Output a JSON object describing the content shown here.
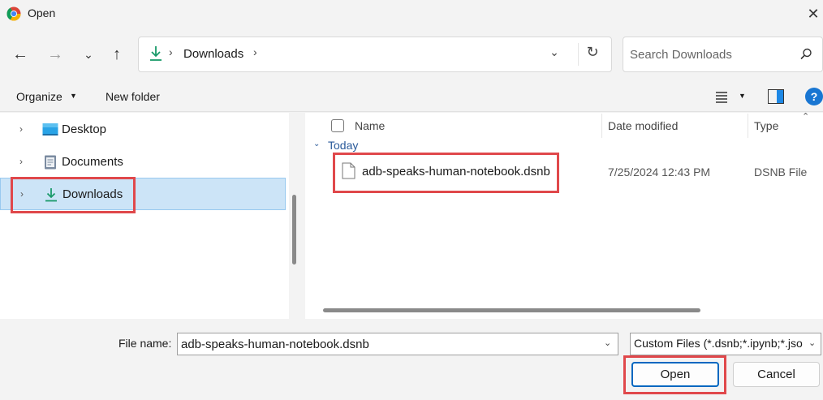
{
  "window": {
    "title": "Open",
    "close_glyph": "✕",
    "app_icon": "chrome-icon"
  },
  "nav": {
    "back_glyph": "←",
    "forward_glyph": "→",
    "recent_glyph": "⌄",
    "up_glyph": "↑",
    "address_icon": "download-icon",
    "address_sep": "›",
    "address_path": "Downloads",
    "address_dropdown_glyph": "⌄",
    "refresh_glyph": "↻",
    "search_placeholder": "Search Downloads"
  },
  "toolbar": {
    "organize_label": "Organize",
    "organize_caret": "▼",
    "new_folder_label": "New folder",
    "view_caret": "▼",
    "help_label": "?"
  },
  "tree": {
    "items": [
      {
        "label": "Desktop",
        "icon": "desktop-icon",
        "chevron": "›"
      },
      {
        "label": "Documents",
        "icon": "documents-icon",
        "chevron": "›"
      },
      {
        "label": "Downloads",
        "icon": "download-icon",
        "chevron": "›",
        "selected": true
      }
    ]
  },
  "files": {
    "columns": {
      "name": "Name",
      "date": "Date modified",
      "type": "Type"
    },
    "scroll_up_glyph": "⌃",
    "group": {
      "toggle_glyph": "⌄",
      "label": "Today"
    },
    "rows": [
      {
        "name": "adb-speaks-human-notebook.dsnb",
        "date": "7/25/2024 12:43 PM",
        "type": "DSNB File",
        "icon": "file-icon"
      }
    ]
  },
  "footer": {
    "file_name_label": "File name:",
    "file_name_value": "adb-speaks-human-notebook.dsnb",
    "file_name_caret": "⌄",
    "filter_value": "Custom Files (*.dsnb;*.ipynb;*.jso",
    "filter_caret": "⌄",
    "open_label": "Open",
    "cancel_label": "Cancel"
  },
  "colors": {
    "highlight": "#e0484b",
    "accent": "#0067c0",
    "selection": "#cce4f7",
    "group_text": "#2a5a9a"
  }
}
